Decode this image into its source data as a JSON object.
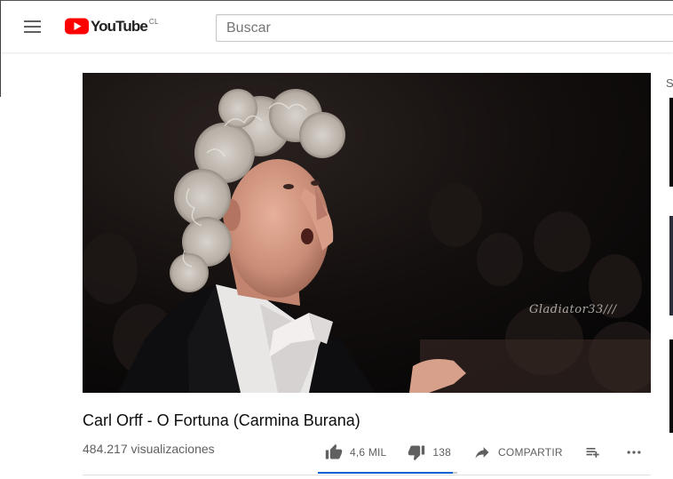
{
  "masthead": {
    "logo_text": "YouTube",
    "country_code": "CL",
    "search_placeholder": "Buscar",
    "search_value": ""
  },
  "video": {
    "title": "Carl Orff - O Fortuna (Carmina Burana)",
    "views": "484.217 visualizaciones",
    "watermark": "Gladiator33///",
    "likes": "4,6 MIL",
    "dislikes": "138",
    "share_label": "COMPARTIR",
    "like_ratio": 0.97
  },
  "sidebar": {
    "partial_letter": "S"
  },
  "icons": {
    "menu": "hamburger-icon",
    "logo": "youtube-play-icon",
    "like": "thumbs-up-icon",
    "dislike": "thumbs-down-icon",
    "share": "share-arrow-icon",
    "add": "playlist-add-icon",
    "more": "more-horizontal-icon"
  },
  "colors": {
    "brand_red": "#ff0000",
    "accent_blue": "#065fd4",
    "text_secondary": "#606060"
  }
}
